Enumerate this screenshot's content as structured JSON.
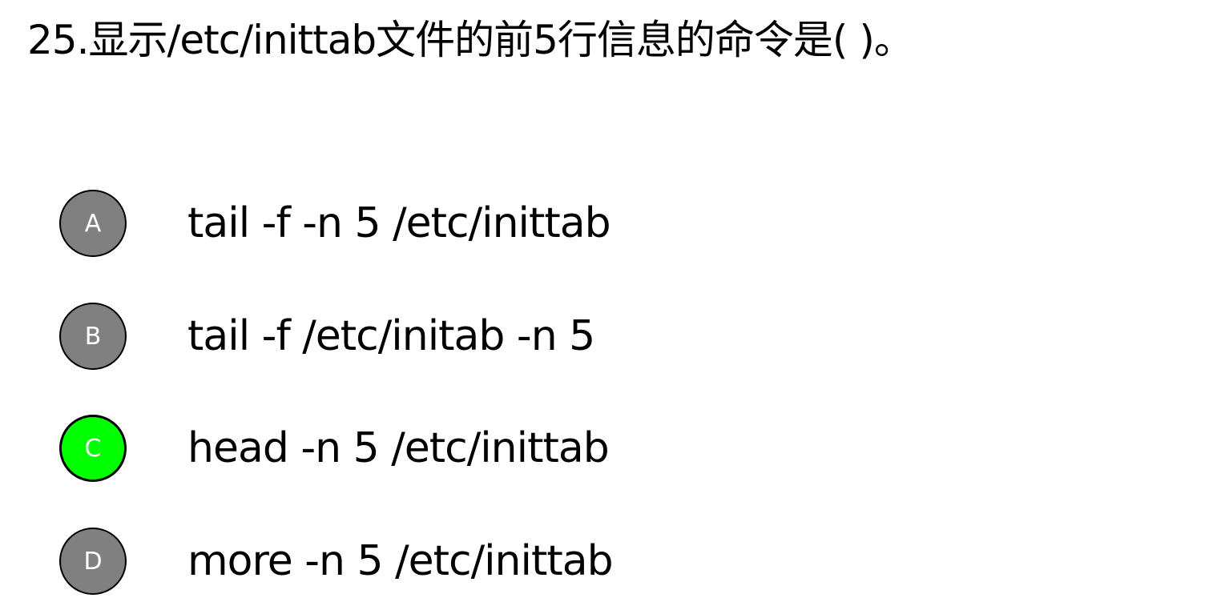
{
  "question": {
    "text": "25.显示/etc/inittab文件的前5行信息的命令是(  )。"
  },
  "options": [
    {
      "letter": "A",
      "text": "tail -f -n 5 /etc/inittab",
      "selected": false
    },
    {
      "letter": "B",
      "text": "tail -f /etc/initab -n 5",
      "selected": false
    },
    {
      "letter": "C",
      "text": "head -n 5 /etc/inittab",
      "selected": true
    },
    {
      "letter": "D",
      "text": "more -n 5 /etc/inittab",
      "selected": false
    }
  ],
  "colors": {
    "badge_default": "#808080",
    "badge_selected": "#00ff00",
    "badge_letter": "#ffffff",
    "text": "#000000",
    "background": "#ffffff"
  }
}
